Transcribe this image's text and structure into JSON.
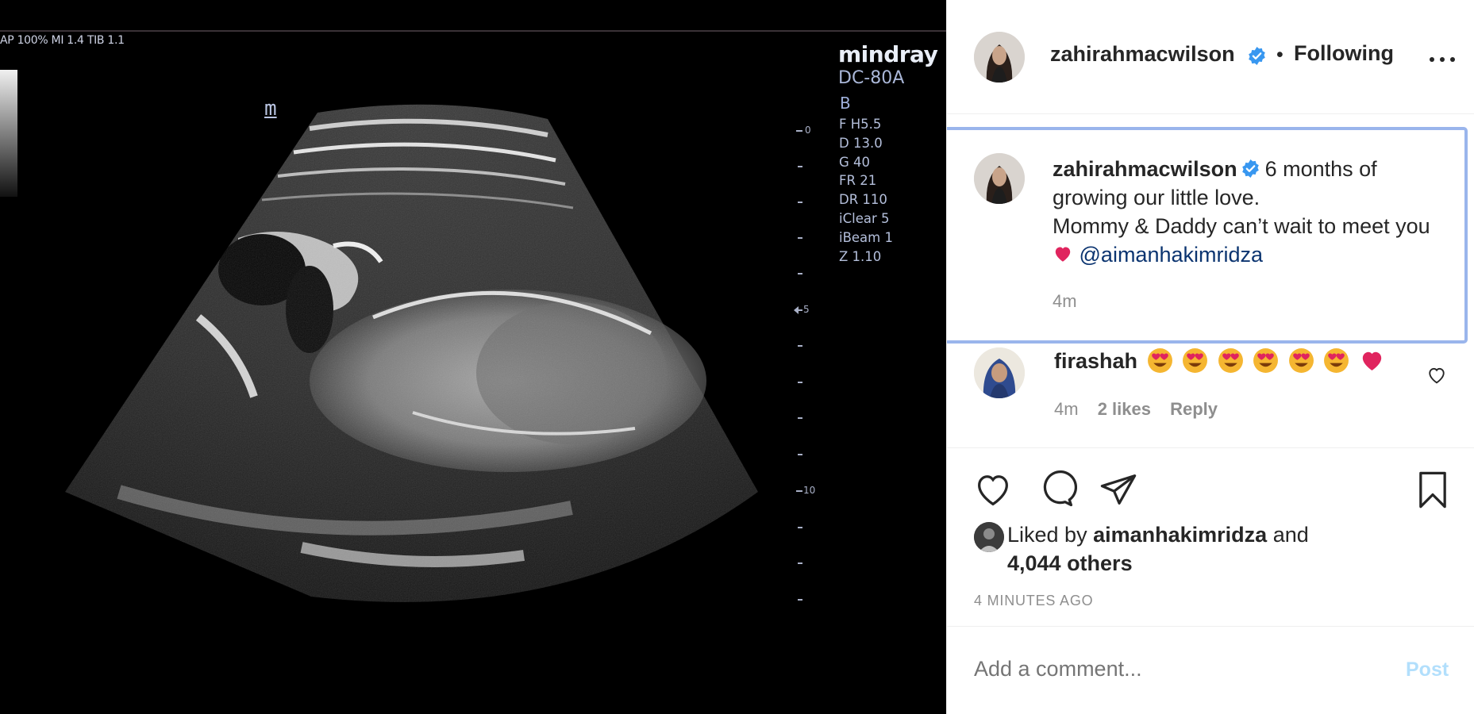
{
  "media": {
    "params": "AP 100%  MI 1.4 TIB 1.1",
    "brand": "mindray",
    "model": "DC-80A",
    "mode": "B",
    "settings": [
      "F H5.5",
      "D 13.0",
      "G 40",
      "FR 21",
      "DR 110",
      "iClear 5",
      "iBeam 1",
      "Z 1.10"
    ],
    "marker": "m",
    "depth_labels": [
      "0",
      "5",
      "10"
    ]
  },
  "header": {
    "username": "zahirahmacwilson",
    "separator": "•",
    "follow_state": "Following"
  },
  "caption": {
    "username": "zahirahmacwilson",
    "line1": "6 months of growing our little love.",
    "line2": "Mommy & Daddy can’t wait to meet you",
    "mention": "@aimanhakimridza",
    "time": "4m"
  },
  "comment": {
    "username": "firashah",
    "emoji_count_heart_eyes": 6,
    "time": "4m",
    "likes": "2 likes",
    "reply": "Reply"
  },
  "likes": {
    "prefix": "Liked by",
    "user": "aimanhakimridza",
    "conj": "and",
    "others": "4,044 others"
  },
  "timestamp": "4 MINUTES AGO",
  "add_comment": {
    "placeholder": "Add a comment...",
    "post_label": "Post"
  },
  "colors": {
    "verified": "#3897f0",
    "mention": "#0b3470",
    "post_disabled": "#b2dffc",
    "highlight_border": "#9ab5ec",
    "heart": "#e0245e"
  },
  "icons": [
    "verified-badge-icon",
    "more-options-icon",
    "heart-icon",
    "comment-icon",
    "share-icon",
    "bookmark-icon",
    "red-heart-emoji",
    "heart-eyes-emoji"
  ]
}
